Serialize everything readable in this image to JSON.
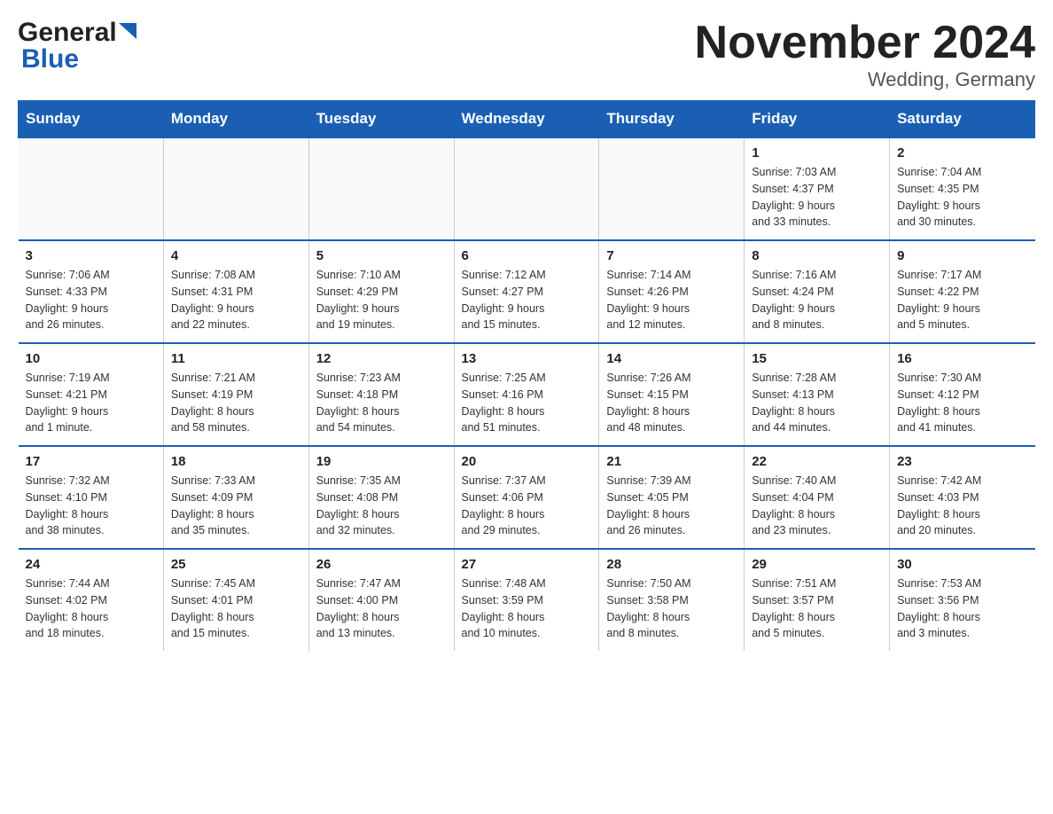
{
  "logo": {
    "general": "General",
    "blue": "Blue",
    "triangle": "▶"
  },
  "title": "November 2024",
  "subtitle": "Wedding, Germany",
  "days_header": [
    "Sunday",
    "Monday",
    "Tuesday",
    "Wednesday",
    "Thursday",
    "Friday",
    "Saturday"
  ],
  "weeks": [
    [
      {
        "day": "",
        "info": ""
      },
      {
        "day": "",
        "info": ""
      },
      {
        "day": "",
        "info": ""
      },
      {
        "day": "",
        "info": ""
      },
      {
        "day": "",
        "info": ""
      },
      {
        "day": "1",
        "info": "Sunrise: 7:03 AM\nSunset: 4:37 PM\nDaylight: 9 hours\nand 33 minutes."
      },
      {
        "day": "2",
        "info": "Sunrise: 7:04 AM\nSunset: 4:35 PM\nDaylight: 9 hours\nand 30 minutes."
      }
    ],
    [
      {
        "day": "3",
        "info": "Sunrise: 7:06 AM\nSunset: 4:33 PM\nDaylight: 9 hours\nand 26 minutes."
      },
      {
        "day": "4",
        "info": "Sunrise: 7:08 AM\nSunset: 4:31 PM\nDaylight: 9 hours\nand 22 minutes."
      },
      {
        "day": "5",
        "info": "Sunrise: 7:10 AM\nSunset: 4:29 PM\nDaylight: 9 hours\nand 19 minutes."
      },
      {
        "day": "6",
        "info": "Sunrise: 7:12 AM\nSunset: 4:27 PM\nDaylight: 9 hours\nand 15 minutes."
      },
      {
        "day": "7",
        "info": "Sunrise: 7:14 AM\nSunset: 4:26 PM\nDaylight: 9 hours\nand 12 minutes."
      },
      {
        "day": "8",
        "info": "Sunrise: 7:16 AM\nSunset: 4:24 PM\nDaylight: 9 hours\nand 8 minutes."
      },
      {
        "day": "9",
        "info": "Sunrise: 7:17 AM\nSunset: 4:22 PM\nDaylight: 9 hours\nand 5 minutes."
      }
    ],
    [
      {
        "day": "10",
        "info": "Sunrise: 7:19 AM\nSunset: 4:21 PM\nDaylight: 9 hours\nand 1 minute."
      },
      {
        "day": "11",
        "info": "Sunrise: 7:21 AM\nSunset: 4:19 PM\nDaylight: 8 hours\nand 58 minutes."
      },
      {
        "day": "12",
        "info": "Sunrise: 7:23 AM\nSunset: 4:18 PM\nDaylight: 8 hours\nand 54 minutes."
      },
      {
        "day": "13",
        "info": "Sunrise: 7:25 AM\nSunset: 4:16 PM\nDaylight: 8 hours\nand 51 minutes."
      },
      {
        "day": "14",
        "info": "Sunrise: 7:26 AM\nSunset: 4:15 PM\nDaylight: 8 hours\nand 48 minutes."
      },
      {
        "day": "15",
        "info": "Sunrise: 7:28 AM\nSunset: 4:13 PM\nDaylight: 8 hours\nand 44 minutes."
      },
      {
        "day": "16",
        "info": "Sunrise: 7:30 AM\nSunset: 4:12 PM\nDaylight: 8 hours\nand 41 minutes."
      }
    ],
    [
      {
        "day": "17",
        "info": "Sunrise: 7:32 AM\nSunset: 4:10 PM\nDaylight: 8 hours\nand 38 minutes."
      },
      {
        "day": "18",
        "info": "Sunrise: 7:33 AM\nSunset: 4:09 PM\nDaylight: 8 hours\nand 35 minutes."
      },
      {
        "day": "19",
        "info": "Sunrise: 7:35 AM\nSunset: 4:08 PM\nDaylight: 8 hours\nand 32 minutes."
      },
      {
        "day": "20",
        "info": "Sunrise: 7:37 AM\nSunset: 4:06 PM\nDaylight: 8 hours\nand 29 minutes."
      },
      {
        "day": "21",
        "info": "Sunrise: 7:39 AM\nSunset: 4:05 PM\nDaylight: 8 hours\nand 26 minutes."
      },
      {
        "day": "22",
        "info": "Sunrise: 7:40 AM\nSunset: 4:04 PM\nDaylight: 8 hours\nand 23 minutes."
      },
      {
        "day": "23",
        "info": "Sunrise: 7:42 AM\nSunset: 4:03 PM\nDaylight: 8 hours\nand 20 minutes."
      }
    ],
    [
      {
        "day": "24",
        "info": "Sunrise: 7:44 AM\nSunset: 4:02 PM\nDaylight: 8 hours\nand 18 minutes."
      },
      {
        "day": "25",
        "info": "Sunrise: 7:45 AM\nSunset: 4:01 PM\nDaylight: 8 hours\nand 15 minutes."
      },
      {
        "day": "26",
        "info": "Sunrise: 7:47 AM\nSunset: 4:00 PM\nDaylight: 8 hours\nand 13 minutes."
      },
      {
        "day": "27",
        "info": "Sunrise: 7:48 AM\nSunset: 3:59 PM\nDaylight: 8 hours\nand 10 minutes."
      },
      {
        "day": "28",
        "info": "Sunrise: 7:50 AM\nSunset: 3:58 PM\nDaylight: 8 hours\nand 8 minutes."
      },
      {
        "day": "29",
        "info": "Sunrise: 7:51 AM\nSunset: 3:57 PM\nDaylight: 8 hours\nand 5 minutes."
      },
      {
        "day": "30",
        "info": "Sunrise: 7:53 AM\nSunset: 3:56 PM\nDaylight: 8 hours\nand 3 minutes."
      }
    ]
  ]
}
